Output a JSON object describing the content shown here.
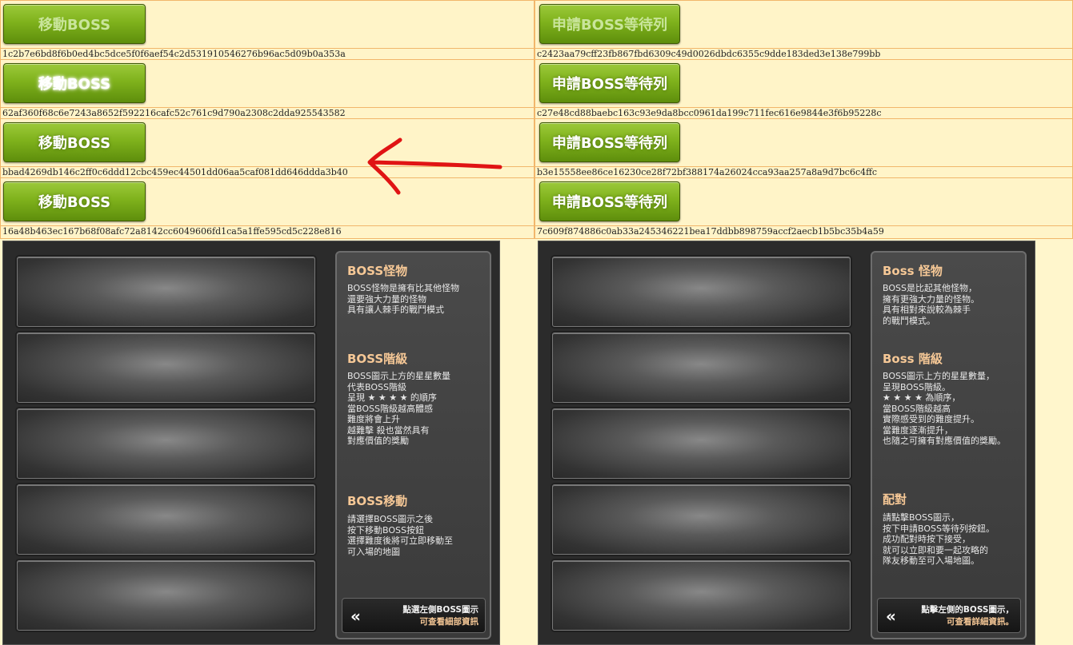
{
  "left_buttons": [
    {
      "label": "移動BOSS",
      "hash": "1c2b7e6bd8f6b0ed4bc5dce5f0f6aef54c2d531910546276b96ac5d09b0a353a"
    },
    {
      "label": "移動BOSS",
      "hash": "62af360f68c6e7243a8652f592216cafc52c761c9d790a2308c2dda925543582"
    },
    {
      "label": "移動BOSS",
      "hash": "bbad4269db146c2ff0c6ddd12cbc459ec44501dd06aa5caf081dd646ddda3b40"
    },
    {
      "label": "移動BOSS",
      "hash": "16a48b463ec167b68f08afc72a8142cc6049606fd1ca5a1ffe595cd5c228e816"
    }
  ],
  "right_buttons": [
    {
      "label": "申請BOSS等待列",
      "hash": "c2423aa79cff23fb867fbd6309c49d0026dbdc6355c9dde183ded3e138e799bb"
    },
    {
      "label": "申請BOSS等待列",
      "hash": "c27e48cd88baebc163c93e9da8bcc0961da199c711fec616e9844e3f6b95228c"
    },
    {
      "label": "申請BOSS等待列",
      "hash": "b3e15558ee86ce16230ce28f72bf388174a26024cca93aa257a8a9d7bc6c4ffc"
    },
    {
      "label": "申請BOSS等待列",
      "hash": "7c609f874886c0ab33a245346221bea17ddbb898759accf2aecb1b5bc35b4a59"
    }
  ],
  "annotation": {
    "arrow_color": "#e01414"
  },
  "left_panel": {
    "sections": [
      {
        "title": "BOSS怪物",
        "body": "BOSS怪物是擁有比其他怪物\n還要強大力量的怪物\n具有讓人棘手的戰鬥模式"
      },
      {
        "title": "BOSS階級",
        "body": "BOSS圖示上方的星星數量\n代表BOSS階級\n呈現 ★ ★ ★ ★ 的順序\n當BOSS階級越高體感\n難度將會上升\n越難擊 殺也當然具有\n對應價值的獎勵"
      },
      {
        "title": "BOSS移動",
        "body": "請選擇BOSS圖示之後\n按下移動BOSS按鈕\n選擇難度後將可立即移動至\n可入場的地圖"
      }
    ],
    "hint_line1": "點選左側BOSS圖示",
    "hint_line2": "可查看細部資訊"
  },
  "right_panel": {
    "sections": [
      {
        "title": "Boss 怪物",
        "body": "BOSS是比起其他怪物，\n擁有更強大力量的怪物。\n具有相對來說較為棘手\n的戰鬥模式。"
      },
      {
        "title": "Boss 階級",
        "body": "BOSS圖示上方的星星數量，\n呈現BOSS階級。\n★ ★ ★ ★ 為順序，\n當BOSS階級越高\n實際感受到的難度提升。\n當難度逐漸提升，\n也隨之可擁有對應價值的獎勵。"
      },
      {
        "title": "配對",
        "body": "請點擊BOSS圖示，\n按下申請BOSS等待列按鈕。\n成功配對時按下接受，\n就可以立即和要一起攻略的\n隊友移動至可入場地圖。"
      }
    ],
    "hint_line1": "點擊左側的BOSS圖示，",
    "hint_line2": "可查看詳細資訊。"
  },
  "icons": {
    "back": "double-chevron-left-icon"
  },
  "chevron": "«"
}
